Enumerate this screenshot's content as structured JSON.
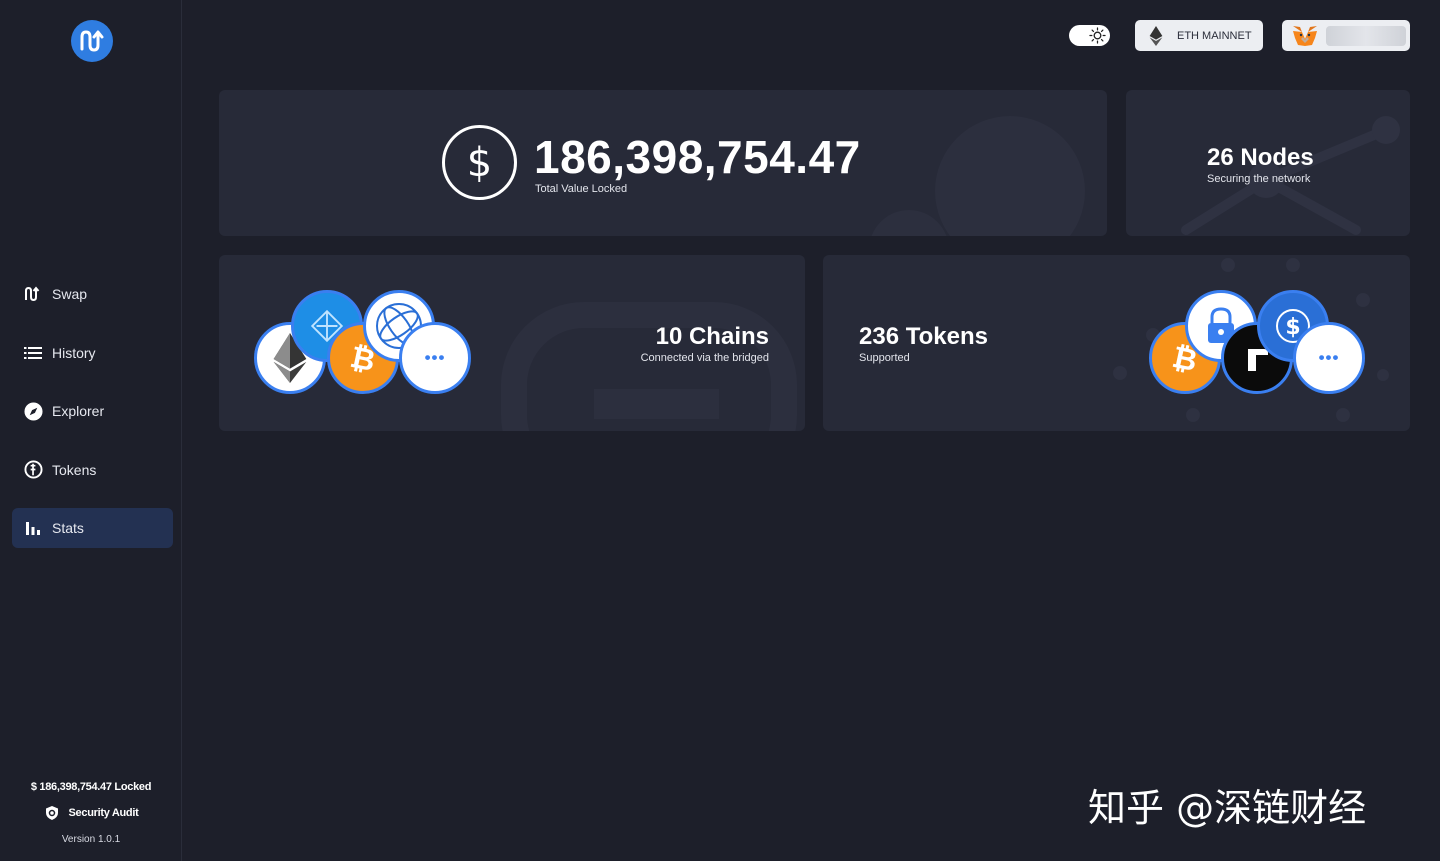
{
  "sidebar": {
    "nav": [
      {
        "label": "Swap",
        "icon": "swap-icon",
        "active": false
      },
      {
        "label": "History",
        "icon": "list-icon",
        "active": false
      },
      {
        "label": "Explorer",
        "icon": "compass-icon",
        "active": false
      },
      {
        "label": "Tokens",
        "icon": "tokens-icon",
        "active": false
      },
      {
        "label": "Stats",
        "icon": "bar-chart-icon",
        "active": true
      }
    ],
    "locked_text": "$ 186,398,754.47 Locked",
    "audit_label": "Security Audit",
    "version": "Version 1.0.1"
  },
  "topbar": {
    "network_label": "ETH MAINNET"
  },
  "stats": {
    "tvl_value": "186,398,754.47",
    "tvl_label": "Total Value Locked",
    "dollar_symbol": "$",
    "nodes_title": "26 Nodes",
    "nodes_subtitle": "Securing the network",
    "chains_title": "10 Chains",
    "chains_subtitle": "Connected via the bridged",
    "tokens_title": "236 Tokens",
    "tokens_subtitle": "Supported",
    "more_glyph": "•••"
  },
  "watermark": "知乎 @深链财经",
  "colors": {
    "accent": "#2f7de1",
    "background": "#1d1f2a",
    "card": "#272a38",
    "active_nav": "#233152",
    "bitcoin": "#f7931a"
  }
}
